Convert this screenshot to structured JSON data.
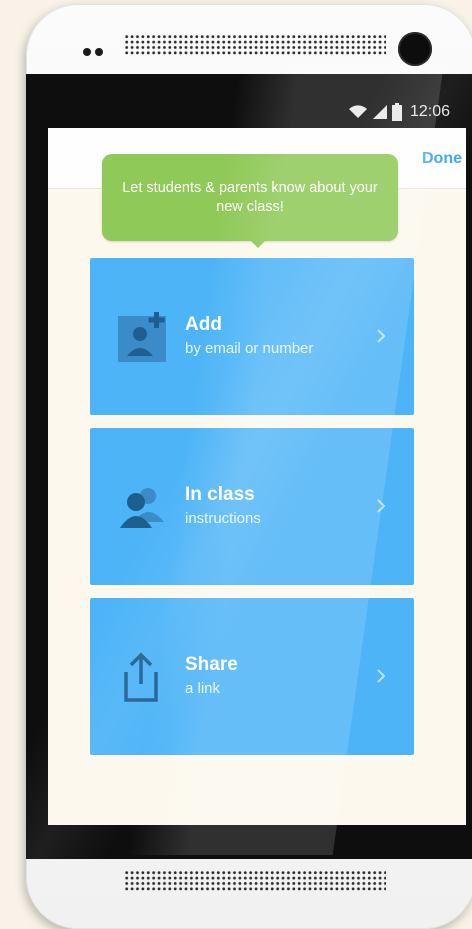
{
  "status_bar": {
    "time": "12:06",
    "icons": [
      "wifi-icon",
      "signal-icon",
      "battery-icon"
    ]
  },
  "header": {
    "done_label": "Done"
  },
  "tooltip": {
    "text": "Let students & parents know about your new class!"
  },
  "options": [
    {
      "title": "Add",
      "subtitle": "by email or number",
      "icon": "add-contact-icon"
    },
    {
      "title": "In class",
      "subtitle": "instructions",
      "icon": "people-icon"
    },
    {
      "title": "Share",
      "subtitle": "a link",
      "icon": "share-icon"
    }
  ],
  "colors": {
    "card": "#4db4f7",
    "tooltip": "#8fc957",
    "accent": "#3da8ec",
    "screen_bg": "#fcf8ed"
  }
}
